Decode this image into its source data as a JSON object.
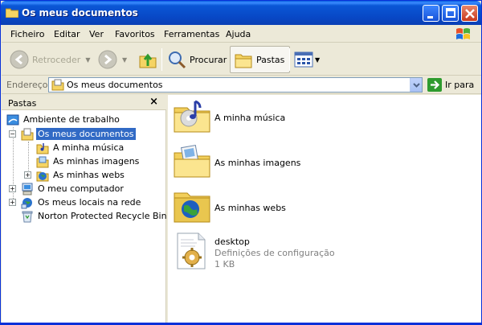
{
  "window": {
    "title": "Os meus documentos"
  },
  "menu": [
    "Ficheiro",
    "Editar",
    "Ver",
    "Favoritos",
    "Ferramentas",
    "Ajuda"
  ],
  "toolbar": {
    "back_label": "Retroceder",
    "search_label": "Procurar",
    "folders_label": "Pastas"
  },
  "address": {
    "label": "Endereço",
    "value": "Os meus documentos",
    "go_label": "Ir para"
  },
  "folders_pane": {
    "title": "Pastas",
    "close": "×",
    "tree": [
      {
        "label": "Ambiente de trabalho"
      },
      {
        "label": "Os meus documentos"
      },
      {
        "label": "A minha música"
      },
      {
        "label": "As minhas imagens"
      },
      {
        "label": "As minhas webs"
      },
      {
        "label": "O meu computador"
      },
      {
        "label": "Os meus locais na rede"
      },
      {
        "label": "Norton Protected Recycle Bin"
      }
    ]
  },
  "content": {
    "items": [
      {
        "name": "A minha música",
        "icon": "music-folder-icon"
      },
      {
        "name": "As minhas imagens",
        "icon": "pictures-folder-icon"
      },
      {
        "name": "As minhas webs",
        "icon": "web-folder-icon"
      },
      {
        "name": "desktop",
        "type": "Definições de configuração",
        "size": "1 KB",
        "icon": "config-file-icon"
      }
    ]
  },
  "colors": {
    "titlebar": "#0a57d6",
    "selection": "#316ac5",
    "accent_green": "#2e9b2e"
  }
}
